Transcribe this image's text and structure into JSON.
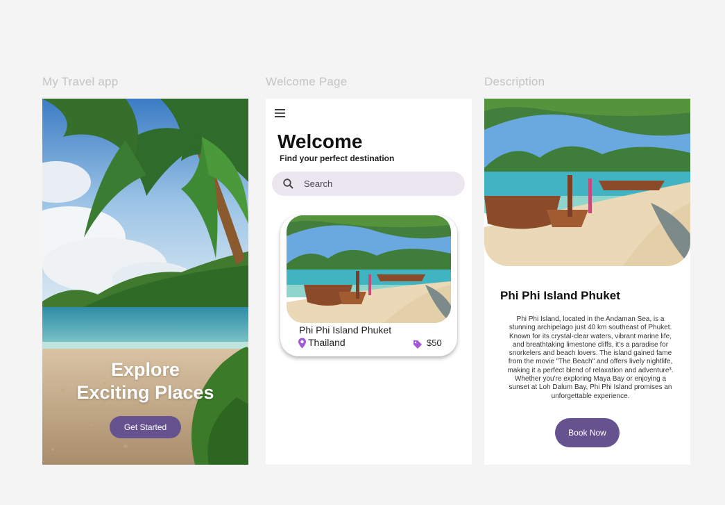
{
  "frames": {
    "travel": {
      "label": "My Travel app",
      "hero_line1": "Explore",
      "hero_line2": "Exciting Places",
      "button": "Get Started"
    },
    "welcome": {
      "label": "Welcome Page",
      "title": "Welcome",
      "subtitle": "Find your perfect destination",
      "search_placeholder": "Search",
      "card": {
        "title": "Phi Phi Island Phuket",
        "country": "Thailand",
        "price": "$50"
      }
    },
    "description": {
      "label": "Description",
      "title": "Phi Phi Island Phuket",
      "body": "Phi Phi Island, located in the Andaman Sea, is a stunning archipelago just 40 km southeast of Phuket. Known for its crystal-clear waters, vibrant marine life, and breathtaking limestone cliffs, it's a paradise for snorkelers and beach lovers. The island gained fame from the movie \"The Beach\" and offers lively nightlife, making it a perfect blend of relaxation and adventure³. Whether you're exploring Maya Bay or enjoying a sunset at Loh Dalum Bay, Phi Phi Island promises an unforgettable experience.",
      "button": "Book Now"
    }
  },
  "colors": {
    "accent": "#66528f",
    "search_bg": "#ece6f0",
    "icon_purple": "#a25ad9",
    "canvas": "#f4f4f4"
  },
  "icons": [
    "menu-icon",
    "search-icon",
    "location-pin-icon",
    "price-tag-icon"
  ]
}
